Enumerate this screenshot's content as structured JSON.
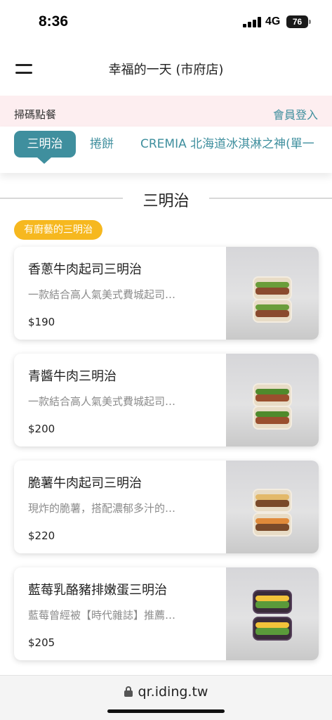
{
  "status": {
    "time": "8:36",
    "network": "4G",
    "battery": "76"
  },
  "header": {
    "store_name": "幸福的一天 (市府店)"
  },
  "subbar": {
    "scan_order": "掃碼點餐",
    "member_login": "會員登入"
  },
  "tabs": [
    {
      "label": "三明治",
      "active": true
    },
    {
      "label": "捲餅",
      "active": false
    },
    {
      "label": "CREMIA 北海道冰淇淋之神(單一",
      "active": false
    }
  ],
  "section": {
    "title": "三明治",
    "tag": "有廚藝的三明治"
  },
  "items": [
    {
      "name": "香蔥牛肉起司三明治",
      "desc": "一款結合高人氣美式費城起司…",
      "price": "$190"
    },
    {
      "name": "青醬牛肉三明治",
      "desc": "一款結合高人氣美式費城起司…",
      "price": "$200"
    },
    {
      "name": "脆薯牛肉起司三明治",
      "desc": "現炸的脆薯，搭配濃郁多汁的…",
      "price": "$220"
    },
    {
      "name": "藍莓乳酪豬排嫩蛋三明治",
      "desc": "藍莓曾經被【時代雜誌】推薦…",
      "price": "$205"
    }
  ],
  "browser": {
    "url": "qr.iding.tw"
  },
  "colors": {
    "accent": "#3f8f9e",
    "tag": "#f6b81f",
    "subbar_bg": "#fdeef0"
  }
}
